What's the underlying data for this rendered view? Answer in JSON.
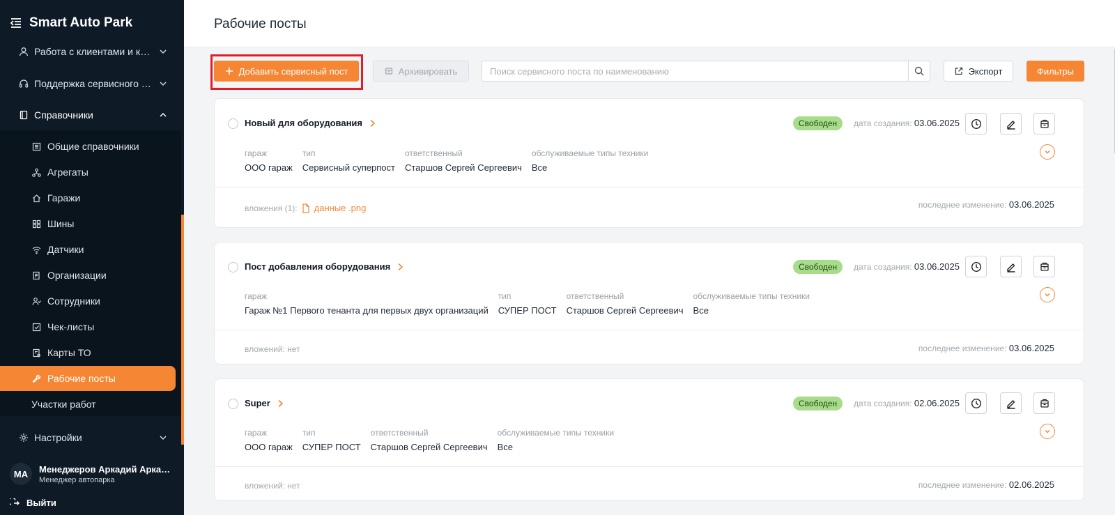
{
  "app": {
    "title": "Smart Auto Park"
  },
  "sidebar": {
    "groups": [
      {
        "label": "Работа с клиентами и качеством",
        "icon": "user-icon"
      },
      {
        "label": "Поддержка сервисного персонала",
        "icon": "headset-icon"
      },
      {
        "label": "Справочники",
        "icon": "book-icon"
      }
    ],
    "sub_items": [
      {
        "label": "Общие справочники",
        "icon": "list-icon"
      },
      {
        "label": "Агрегаты",
        "icon": "network-icon"
      },
      {
        "label": "Гаражи",
        "icon": "home-icon"
      },
      {
        "label": "Шины",
        "icon": "grid-icon"
      },
      {
        "label": "Датчики",
        "icon": "wifi-icon"
      },
      {
        "label": "Организации",
        "icon": "document-icon"
      },
      {
        "label": "Сотрудники",
        "icon": "people-icon"
      },
      {
        "label": "Чек-листы",
        "icon": "checkbox-icon"
      },
      {
        "label": "Карты ТО",
        "icon": "card-icon"
      },
      {
        "label": "Рабочие посты",
        "icon": "wrench-icon"
      },
      {
        "label": "Участки работ",
        "icon": ""
      }
    ],
    "settings_label": "Настройки",
    "user": {
      "initials": "MA",
      "name": "Менеджеров Аркадий Аркадьевич",
      "role": "Менеджер автопарка"
    },
    "logout_label": "Выйти"
  },
  "header": {
    "title": "Рабочие посты"
  },
  "toolbar": {
    "add_label": "Добавить сервисный пост",
    "archive_label": "Архивировать",
    "search_placeholder": "Поиск сервисного поста по наименованию",
    "export_label": "Экспорт",
    "filters_label": "Фильтры"
  },
  "labels": {
    "created": "дата создания:",
    "modified": "последнее изменение:",
    "garage": "гараж",
    "type": "тип",
    "responsible": "ответственный",
    "equipment_types": "обслуживаемые типы техники"
  },
  "posts": [
    {
      "name": "Новый для оборудования",
      "status": "Свободен",
      "created": "03.06.2025",
      "garage": "ООО гараж",
      "type": "Сервисный суперпост",
      "responsible": "Старшов Сергей Сергеевич",
      "equipment": "Все",
      "attachments_label": "вложения (1):",
      "attachment_file": "данные .png",
      "modified": "03.06.2025"
    },
    {
      "name": "Пост добавления оборудования",
      "status": "Свободен",
      "created": "03.06.2025",
      "garage": "Гараж №1 Первого тенанта для первых двух организаций",
      "type": "СУПЕР ПОСТ",
      "responsible": "Старшов Сергей Сергеевич",
      "equipment": "Все",
      "attachments_label": "вложений: нет",
      "modified": "03.06.2025"
    },
    {
      "name": "Super",
      "status": "Свободен",
      "created": "02.06.2025",
      "garage": "ООО гараж",
      "type": "СУПЕР ПОСТ",
      "responsible": "Старшов Сергей Сергеевич",
      "equipment": "Все",
      "attachments_label": "вложений: нет",
      "modified": "02.06.2025"
    }
  ],
  "colors": {
    "accent": "#f58634",
    "sidebar_bg": "#0e1a26",
    "status_free": "#a7dc8a",
    "highlight": "#e11d2a"
  }
}
